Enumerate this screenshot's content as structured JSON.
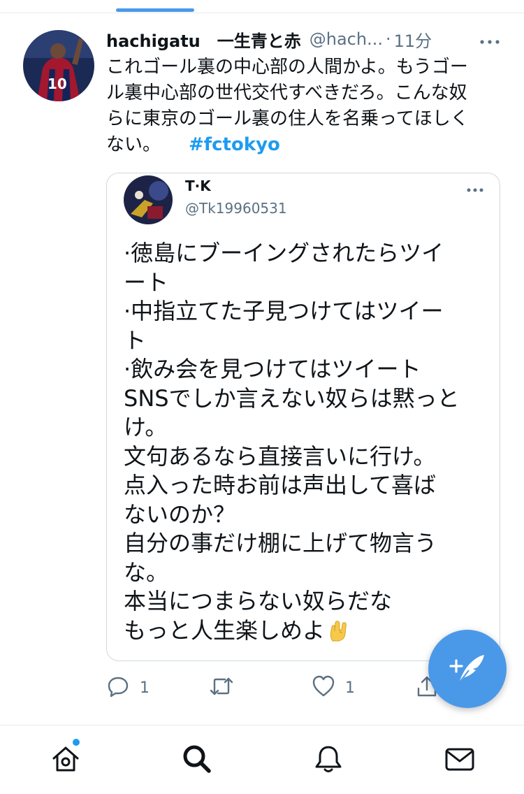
{
  "tweet": {
    "display_name": "hachigatu　一生青と赤",
    "handle": "@hach...",
    "separator": "·",
    "time": "11分",
    "text_lines": [
      "これゴール裏の中心部の人間かよ。もうゴー",
      "ル裏中心部の世代交代すべきだろ。こんな奴",
      "らに東京のゴール裏の住人を名乗ってほしく",
      "ない。"
    ],
    "hashtag": "#fctokyo"
  },
  "quote": {
    "name": "T·K",
    "handle": "@Tk19960531",
    "lines": [
      "·徳島にブーイングされたらツイ",
      "ート",
      "·中指立てた子見つけてはツイー",
      "ト",
      "·飲み会を見つけてはツイート",
      "SNSでしか言えない奴らは黙っと",
      "け。",
      "文句あるなら直接言いに行け。",
      "点入った時お前は声出して喜ば",
      "ないのか？",
      "自分の事だけ棚に上げて物言う",
      "な。",
      "本当につまらない奴らだな",
      "もっと人生楽しめよ"
    ]
  },
  "actions": {
    "reply_count": "1",
    "like_count": "1"
  },
  "icons": {
    "more": "more-icon",
    "reply": "reply-icon",
    "retweet": "retweet-icon",
    "like": "heart-icon",
    "share": "share-icon",
    "compose": "compose-tweet-icon",
    "home": "home-icon",
    "search": "search-icon",
    "notifications": "bell-icon",
    "messages": "mail-icon"
  },
  "colors": {
    "accent": "#1d9bf0",
    "fab": "#4a99e9",
    "secondary_text": "#5b7083"
  }
}
